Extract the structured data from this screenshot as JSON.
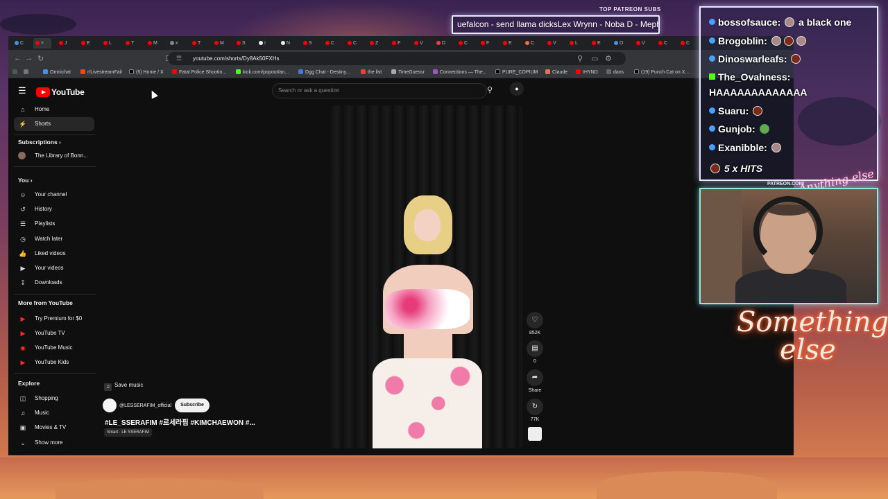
{
  "overlay": {
    "top_label": "TOP PATREON SUBS",
    "ticker_text": "uefalcon - send llama dicksLex Wrynn -  Noba D - Mephe",
    "patreon_label": "PATREON.COM/",
    "neon_logo": "Anything else",
    "neon_sign_line1": "Something",
    "neon_sign_line2": "else"
  },
  "chat": {
    "messages": [
      {
        "user": "bossofsauce:",
        "text": "a black one"
      },
      {
        "user": "Brogoblin:",
        "text": ""
      },
      {
        "user": "Dinoswarleafs:",
        "text": ""
      },
      {
        "user": "The_Ovahness:",
        "text": "HAAAAAAAAAAAAA"
      },
      {
        "user": "Suaru:",
        "text": ""
      },
      {
        "user": "Gunjob:",
        "text": ""
      },
      {
        "user": "Exanibble:",
        "text": ""
      }
    ],
    "hits": "5 x HITS"
  },
  "browser": {
    "url": "youtube.com/shorts/Dy8Ak50FXHs",
    "bookmarks": [
      "Omnichat",
      "r/LivestreamFail",
      "(5) Home / X",
      "Fatal Police Shootin...",
      "kick.com/popout/an...",
      "Dgg Chat - Destiny...",
      "the list",
      "TimeGuessr",
      "Connections — The...",
      "PURE_COPIUM",
      "Claude",
      "IHYND",
      "dans",
      "(19) Punch Cat on X..."
    ]
  },
  "youtube": {
    "logo": "YouTube",
    "search_placeholder": "Search or ask a question",
    "nav": {
      "home": "Home",
      "shorts": "Shorts",
      "subscriptions": "Subscriptions",
      "sub_channel": "The Library of Bonn...",
      "you": "You",
      "your_channel": "Your channel",
      "history": "History",
      "playlists": "Playlists",
      "watch_later": "Watch later",
      "liked_videos": "Liked videos",
      "your_videos": "Your videos",
      "downloads": "Downloads",
      "more_from": "More from YouTube",
      "premium": "Try Premium for $0",
      "yt_tv": "YouTube TV",
      "yt_music": "YouTube Music",
      "yt_kids": "YouTube Kids",
      "explore": "Explore",
      "shopping": "Shopping",
      "music": "Music",
      "movies": "Movies & TV",
      "show_more": "Show more"
    },
    "short": {
      "save_music": "Save music",
      "channel": "@LESSERAFIM_official",
      "subscribe": "Subscribe",
      "title": "#LE_SSERAFIM #르세라핌 #KIMCHAEWON #...",
      "song": "Smart · LE SSERAFIM",
      "likes": "852K",
      "comments": "0",
      "share": "Share",
      "remix": "77K"
    }
  }
}
